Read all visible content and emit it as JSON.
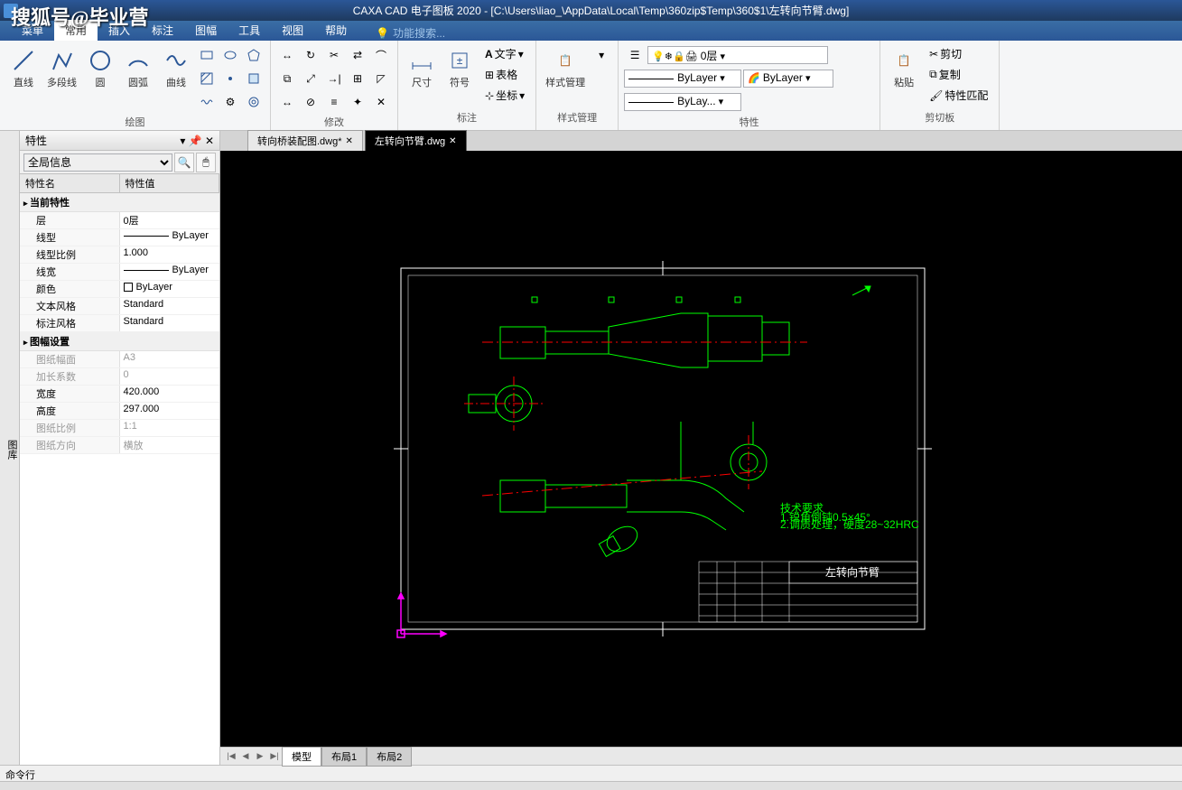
{
  "watermark": "搜狐号@毕业营",
  "title": "CAXA CAD 电子图板 2020 - [C:\\Users\\liao_\\AppData\\Local\\Temp\\360zip$Temp\\360$1\\左转向节臂.dwg]",
  "menu": {
    "items": [
      "菜单",
      "常用",
      "插入",
      "标注",
      "图幅",
      "工具",
      "视图",
      "帮助"
    ],
    "active": 1,
    "search": "功能搜索..."
  },
  "ribbon": {
    "draw": {
      "label": "绘图",
      "line": "直线",
      "polyline": "多段线",
      "circle": "圆",
      "arc": "圆弧",
      "spline": "曲线"
    },
    "modify": {
      "label": "修改"
    },
    "dim": {
      "label": "标注",
      "d1": "尺寸",
      "d2": "符号",
      "t1": "文字",
      "t2": "表格",
      "t3": "坐标"
    },
    "style": {
      "label": "样式管理",
      "btn": "样式管理"
    },
    "props": {
      "label": "特性",
      "layer": "0层",
      "ltype": "ByLayer",
      "color": "ByLayer",
      "lweight": "ByLay..."
    },
    "clip": {
      "label": "剪切板",
      "paste": "粘贴",
      "cut": "剪切",
      "copy": "复制",
      "match": "特性匹配"
    }
  },
  "propsPanel": {
    "title": "特性",
    "selector": "全局信息",
    "colName": "特性名",
    "colValue": "特性值",
    "cats": [
      {
        "name": "当前特性",
        "rows": [
          {
            "k": "层",
            "v": "0层"
          },
          {
            "k": "线型",
            "v": "ByLayer",
            "line": true
          },
          {
            "k": "线型比例",
            "v": "1.000"
          },
          {
            "k": "线宽",
            "v": "ByLayer",
            "line": true
          },
          {
            "k": "颜色",
            "v": "ByLayer",
            "box": true
          },
          {
            "k": "文本风格",
            "v": "Standard"
          },
          {
            "k": "标注风格",
            "v": "Standard"
          }
        ]
      },
      {
        "name": "图幅设置",
        "rows": [
          {
            "k": "图纸幅面",
            "v": "A3",
            "ro": true
          },
          {
            "k": "加长系数",
            "v": "0",
            "ro": true
          },
          {
            "k": "宽度",
            "v": "420.000"
          },
          {
            "k": "高度",
            "v": "297.000"
          },
          {
            "k": "图纸比例",
            "v": "1:1",
            "ro": true
          },
          {
            "k": "图纸方向",
            "v": "横放",
            "ro": true
          }
        ]
      }
    ]
  },
  "sidebar": "图库",
  "docTabs": [
    {
      "label": "转向桥装配图.dwg*",
      "active": false
    },
    {
      "label": "左转向节臂.dwg",
      "active": true
    }
  ],
  "layoutTabs": [
    "模型",
    "布局1",
    "布局2"
  ],
  "cmdline": "命令行",
  "titleBlock": "左转向节臂"
}
